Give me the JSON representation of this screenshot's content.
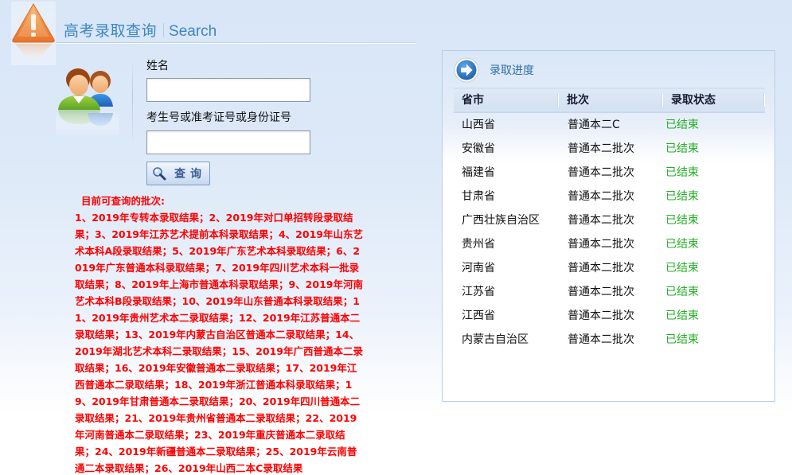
{
  "header": {
    "logo_icon": "warning-triangle-icon",
    "title_cn": "高考录取查询",
    "title_en": "Search"
  },
  "form": {
    "avatar_icon": "users-icon",
    "name_label": "姓名",
    "name_value": "",
    "name_placeholder": "",
    "id_label": "考生号或准考证号或身份证号",
    "id_value": "",
    "id_placeholder": "",
    "query_button": {
      "icon": "magnifier-icon",
      "label": "查询"
    }
  },
  "notice": {
    "heading": "目前可查询的批次:",
    "text": "1、2019年专转本录取结果；2、2019年对口单招转段录取结果；3、2019年江苏艺术提前本科录取结果；4、2019年山东艺术本科A段录取结果；5、2019年广东艺术本科录取结果；6、2019年广东普通本科录取结果；7、2019年四川艺术本科一批录取结果；8、2019年上海市普通本科录取结果；9、2019年河南艺术本科B段录取结果；10、2019年山东普通本科录取结果；11、2019年贵州艺术本二录取结果；12、2019年江苏普通本二录取结果；13、2019年内蒙古自治区普通本二录取结果；14、2019年湖北艺术本科二录取结果；15、2019年广西普通本二录取结果；16、2019年安徽普通本二录取结果；17、2019年江西普通本二录取结果；18、2019年浙江普通本科录取结果；19、2019年甘肃普通本二录取结果；20、2019年四川普通本二录取结果；21、2019年贵州省普通本二录取结果；22、2019年河南普通本二录取结果；23、2019年重庆普通本二录取结果；24、2019年新疆普通本二录取结果；25、2019年云南普通二本录取结果；26、2019年山西二本C录取结果"
  },
  "progress": {
    "icon": "arrow-right-circle-icon",
    "title": "录取进度",
    "columns": [
      "省市",
      "批次",
      "录取状态"
    ],
    "status_color": "#23b023",
    "rows": [
      {
        "province": "山西省",
        "batch": "普通本二C",
        "status": "已结束"
      },
      {
        "province": "安徽省",
        "batch": "普通本二批次",
        "status": "已结束"
      },
      {
        "province": "福建省",
        "batch": "普通本二批次",
        "status": "已结束"
      },
      {
        "province": "甘肃省",
        "batch": "普通本二批次",
        "status": "已结束"
      },
      {
        "province": "广西壮族自治区",
        "batch": "普通本二批次",
        "status": "已结束"
      },
      {
        "province": "贵州省",
        "batch": "普通本二批次",
        "status": "已结束"
      },
      {
        "province": "河南省",
        "batch": "普通本二批次",
        "status": "已结束"
      },
      {
        "province": "江苏省",
        "batch": "普通本二批次",
        "status": "已结束"
      },
      {
        "province": "江西省",
        "batch": "普通本二批次",
        "status": "已结束"
      },
      {
        "province": "内蒙古自治区",
        "batch": "普通本二批次",
        "status": "已结束"
      }
    ]
  }
}
